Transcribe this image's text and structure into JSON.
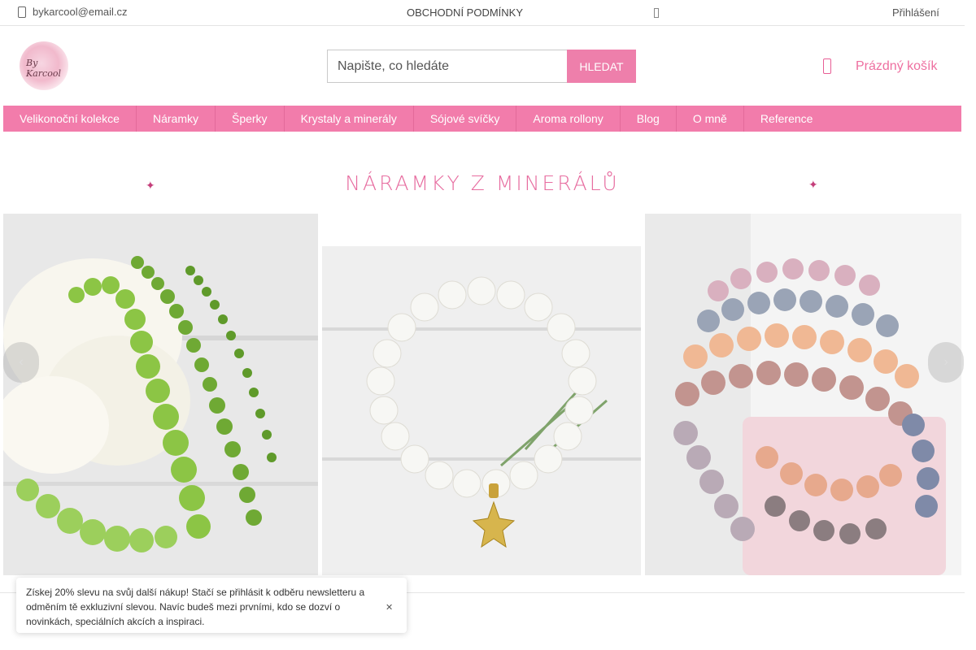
{
  "topbar": {
    "email": "bykarcool@email.cz",
    "terms": "OBCHODNÍ PODMÍNKY",
    "login": "Přihlášení"
  },
  "header": {
    "logo_text": "By Karcool",
    "search_placeholder": "Napište, co hledáte",
    "search_button": "HLEDAT",
    "cart_label": "Prázdný košík"
  },
  "nav": {
    "items": [
      "Velikonoční kolekce",
      "Náramky",
      "Šperky",
      "Krystaly a minerály",
      "Sójové svíčky",
      "Aroma rollony",
      "Blog",
      "O mně",
      "Reference"
    ]
  },
  "banner": {
    "title": "NÁRAMKY Z MINERÁLŮ",
    "photos": [
      {
        "icon": "green-peridot-bracelets-photo"
      },
      {
        "icon": "white-moonstone-bracelet-photo"
      },
      {
        "icon": "mixed-stone-bracelets-photo"
      }
    ]
  },
  "popup": {
    "text": "Získej 20% slevu na svůj další nákup!  Stačí se přihlásit k odběru newsletteru a odměním tě exkluzivní slevou. Navíc budeš mezi prvními, kdo se dozví o novinkách, speciálních akcích a inspiraci."
  },
  "colors": {
    "accent": "#f27cab",
    "accent_text": "#e76da0",
    "search_button": "#ee7fab"
  }
}
